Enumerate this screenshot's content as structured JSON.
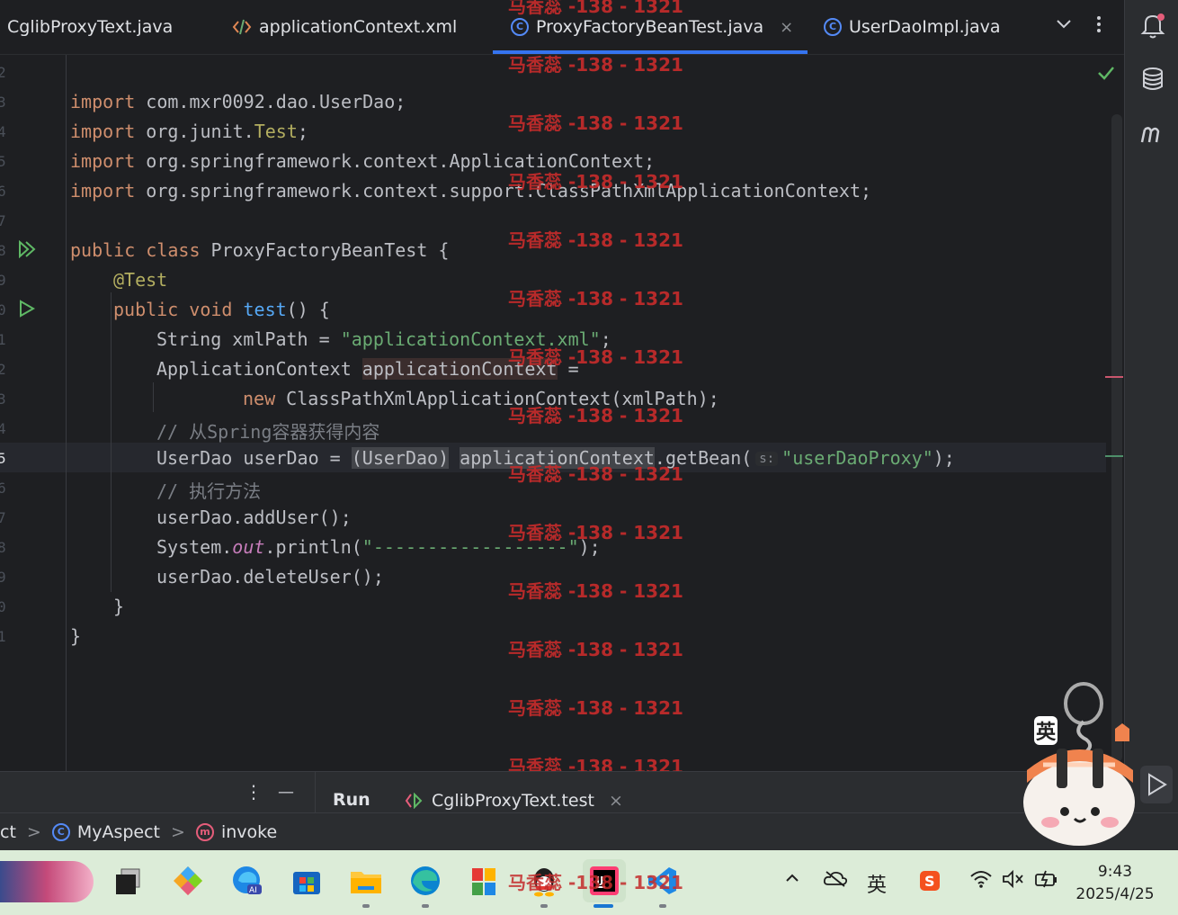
{
  "tabs": [
    {
      "label": "CglibProxyText.java",
      "icon": "java-class-icon"
    },
    {
      "label": "applicationContext.xml",
      "icon": "xml-file-icon"
    },
    {
      "label": "ProxyFactoryBeanTest.java",
      "icon": "class-c-icon",
      "active": true
    },
    {
      "label": "UserDaoImpl.java",
      "icon": "class-c-icon"
    }
  ],
  "tab_close_glyph": "×",
  "class_icon_letter": "C",
  "line_numbers": [
    "2",
    "3",
    "4",
    "5",
    "6",
    "7",
    "8",
    "9",
    "0",
    "1",
    "2",
    "3",
    "4",
    "5",
    "6",
    "7",
    "8",
    "9",
    "0",
    "1"
  ],
  "code": {
    "l3_kw": "import",
    "l3_rest": " com.mxr0092.dao.UserDao;",
    "l4_kw": "import",
    "l4_a": " org.junit.",
    "l4_cls": "Test",
    "l4_end": ";",
    "l5_kw": "import",
    "l5_rest": " org.springframework.context.ApplicationContext;",
    "l6_kw": "import",
    "l6_rest": " org.springframework.context.support.ClassPathXmlApplicationContext;",
    "l8_kw": "public class",
    "l8_rest": " ProxyFactoryBeanTest {",
    "l9_ann": "@Test",
    "l10_kw": "public void",
    "l10_fn": "test",
    "l10_rest": "() {",
    "l11_a": "String xmlPath = ",
    "l11_str": "\"applicationContext.xml\"",
    "l11_end": ";",
    "l12_a": "ApplicationContext ",
    "l12_var": "applicationContext",
    "l12_end": " =",
    "l13_kw": "new",
    "l13_rest": " ClassPathXmlApplicationContext(xmlPath);",
    "l14_cmt": "// 从Spring容器获得内容",
    "l15_a": "UserDao userDao = ",
    "l15_cast": "(UserDao)",
    "l15_var": "applicationContext",
    "l15_b": ".getBean(",
    "l15_hint": "s:",
    "l15_str": "\"userDaoProxy\"",
    "l15_end": ");",
    "l16_cmt": "// 执行方法",
    "l17": "userDao.addUser();",
    "l18_a": "System.",
    "l18_fld": "out",
    "l18_b": ".println(",
    "l18_str": "\"------------------\"",
    "l18_end": ");",
    "l19": "userDao.deleteUser();",
    "l20": "}",
    "l21": "}"
  },
  "watermark": "马香蕊 -138 - 1321",
  "tool_window": {
    "menu_glyph": "⋮",
    "minimize_glyph": "—",
    "run_label": "Run",
    "run_tab": "CglibProxyText.test",
    "close_glyph": "×"
  },
  "breadcrumb": {
    "first": "ct",
    "class": "MyAspect",
    "method": "invoke",
    "method_letter": "m",
    "sep": ">"
  },
  "ime_sticker": "英",
  "tray": {
    "ime": "英",
    "up": "^"
  },
  "clock": {
    "time": "9:43",
    "date": "2025/4/25"
  },
  "colors": {
    "accent": "#3574f0",
    "watermark": "#c42b2b",
    "taskbar": "#dcecd8",
    "editor_bg": "#1e1f22"
  }
}
